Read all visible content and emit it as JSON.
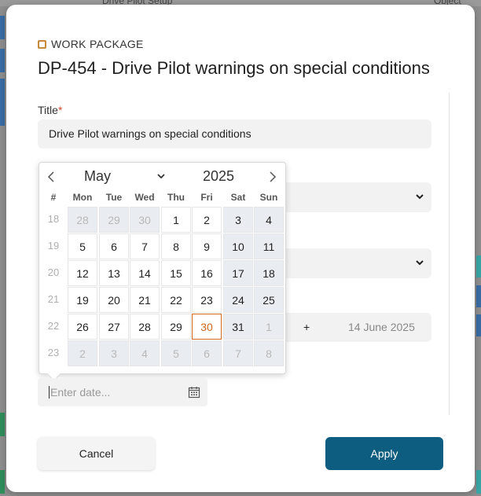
{
  "background": {
    "top_text": "Drive Pilot Setup",
    "right_text": "Object"
  },
  "modal": {
    "type_label": "WORK PACKAGE",
    "title": "DP-454 - Drive Pilot warnings on special conditions",
    "title_field": {
      "label": "Title",
      "required_mark": "*",
      "value": "Drive Pilot warnings on special conditions"
    },
    "duration": {
      "plus": "+",
      "end_date": "14 June 2025"
    },
    "date_input": {
      "placeholder": "Enter date..."
    },
    "buttons": {
      "cancel": "Cancel",
      "apply": "Apply"
    }
  },
  "datepicker": {
    "month": "May",
    "year": "2025",
    "week_header": "#",
    "weekdays": [
      "Mon",
      "Tue",
      "Wed",
      "Thu",
      "Fri",
      "Sat",
      "Sun"
    ],
    "weeks": [
      {
        "number": "18",
        "days": [
          {
            "d": "28",
            "o": true
          },
          {
            "d": "29",
            "o": true
          },
          {
            "d": "30",
            "o": true
          },
          {
            "d": "1"
          },
          {
            "d": "2"
          },
          {
            "d": "3"
          },
          {
            "d": "4"
          }
        ]
      },
      {
        "number": "19",
        "days": [
          {
            "d": "5"
          },
          {
            "d": "6"
          },
          {
            "d": "7"
          },
          {
            "d": "8"
          },
          {
            "d": "9"
          },
          {
            "d": "10"
          },
          {
            "d": "11"
          }
        ]
      },
      {
        "number": "20",
        "days": [
          {
            "d": "12"
          },
          {
            "d": "13"
          },
          {
            "d": "14"
          },
          {
            "d": "15"
          },
          {
            "d": "16"
          },
          {
            "d": "17"
          },
          {
            "d": "18"
          }
        ]
      },
      {
        "number": "21",
        "days": [
          {
            "d": "19"
          },
          {
            "d": "20"
          },
          {
            "d": "21"
          },
          {
            "d": "22"
          },
          {
            "d": "23"
          },
          {
            "d": "24"
          },
          {
            "d": "25"
          }
        ]
      },
      {
        "number": "22",
        "days": [
          {
            "d": "26"
          },
          {
            "d": "27"
          },
          {
            "d": "28"
          },
          {
            "d": "29"
          },
          {
            "d": "30",
            "today": true
          },
          {
            "d": "31"
          },
          {
            "d": "1",
            "o": true
          }
        ]
      },
      {
        "number": "23",
        "days": [
          {
            "d": "2",
            "o": true
          },
          {
            "d": "3",
            "o": true
          },
          {
            "d": "4",
            "o": true
          },
          {
            "d": "5",
            "o": true
          },
          {
            "d": "6",
            "o": true
          },
          {
            "d": "7",
            "o": true
          },
          {
            "d": "8",
            "o": true
          }
        ]
      }
    ]
  },
  "colors": {
    "accent": "#0d5d80",
    "today": "#d2691e",
    "required": "#d2472b",
    "weekend_bg": "#e9edf1"
  },
  "icons": {
    "prev": "chevron-left-icon",
    "next": "chevron-right-icon",
    "calendar": "calendar-icon",
    "type": "work-package-type-icon"
  }
}
